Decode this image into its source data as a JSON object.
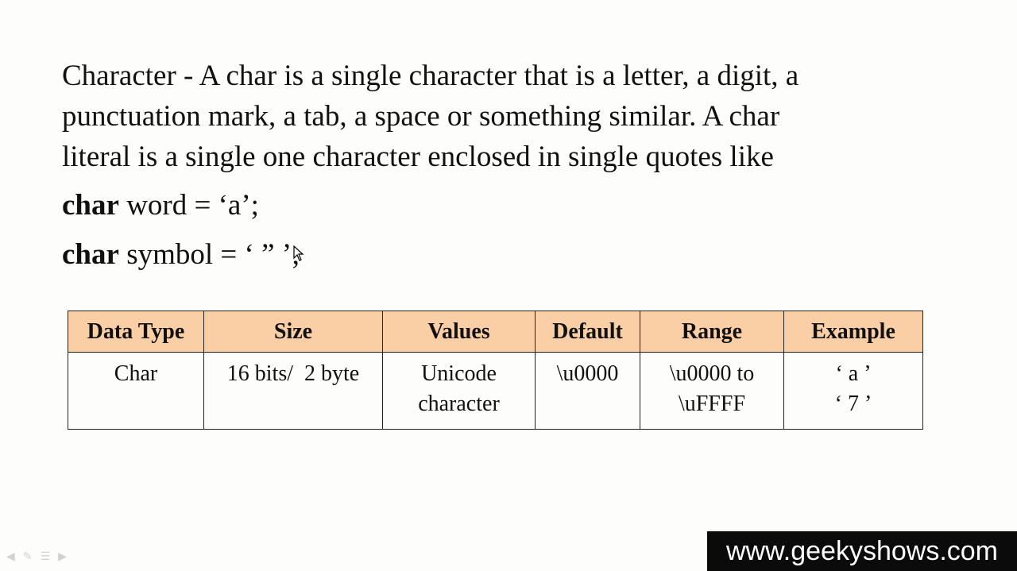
{
  "paragraph": {
    "line1": "Character - A char is a single character that is a letter, a digit, a",
    "line2": "punctuation mark, a tab, a space or something similar. A char",
    "line3": "literal is a single one character enclosed in single quotes like"
  },
  "code": {
    "line1": {
      "keyword": "char",
      "rest": " word = ‘a’;"
    },
    "line2": {
      "keyword": "char",
      "rest": " symbol = ‘ ” ’;"
    }
  },
  "table": {
    "headers": [
      "Data Type",
      "Size",
      "Values",
      "Default",
      "Range",
      "Example"
    ],
    "row": {
      "data_type": "Char",
      "size": "16 bits/  2 byte",
      "values": [
        "Unicode",
        "character"
      ],
      "default": "\\u0000",
      "range": [
        "\\u0000 to",
        "\\uFFFF"
      ],
      "example": [
        "‘ a ’",
        "‘ 7 ’"
      ]
    }
  },
  "watermark": "www.geekyshows.com",
  "colors": {
    "header_background": "#fbcfa6",
    "watermark_background": "#0b0b0b"
  },
  "icons": [
    "mouse-pointer-icon",
    "prev-slide-icon",
    "pen-icon",
    "menu-icon",
    "next-slide-icon"
  ]
}
